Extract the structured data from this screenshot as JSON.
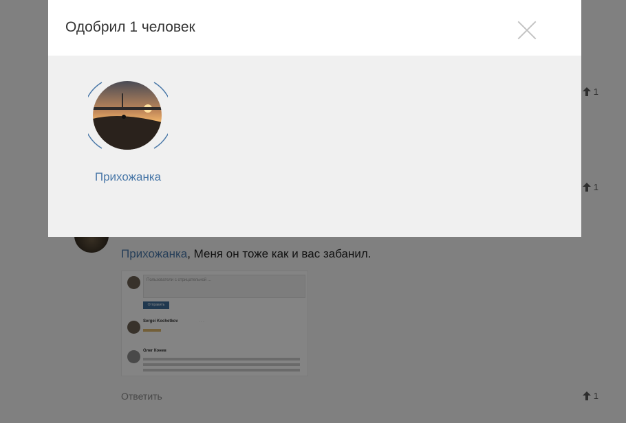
{
  "modal": {
    "title": "Одобрил 1 человек",
    "user_name": "Прихожанка"
  },
  "page": {
    "votes": [
      "1",
      "1",
      "1"
    ],
    "comment": {
      "mention": "Прихожанка",
      "text": ", Меня он тоже как и вас забанил."
    },
    "reply_label": "Ответить",
    "screenshot": {
      "placeholder": "Пользователи с отрицательной ...",
      "button": "Отправить",
      "user1": "Sergei Kochetkov",
      "user2": "Олег Конев"
    }
  },
  "colors": {
    "link": "#4a78a8",
    "overlay": "rgba(0,0,0,0.47)",
    "modal_body": "#f0f0f0"
  },
  "icons": [
    "close-icon",
    "upvote-arrow-icon"
  ]
}
